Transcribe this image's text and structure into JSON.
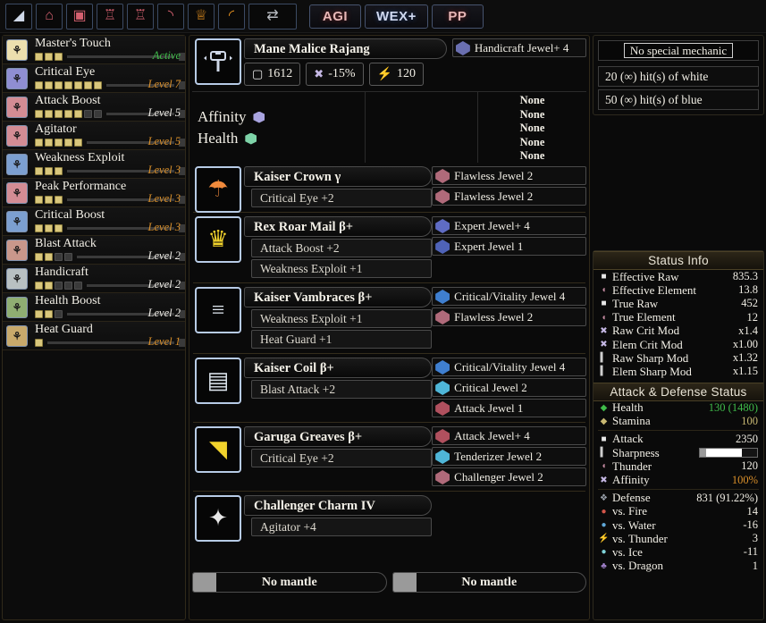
{
  "toolbar": {
    "icons": [
      {
        "name": "weapon-longsword-icon",
        "glyph": "◢"
      },
      {
        "name": "armor-head-icon",
        "glyph": "⌂"
      },
      {
        "name": "armor-chest-icon",
        "glyph": "▣"
      },
      {
        "name": "armor-arms-icon",
        "glyph": "♖"
      },
      {
        "name": "armor-waist-icon",
        "glyph": "♖"
      },
      {
        "name": "armor-legs-icon",
        "glyph": "◝"
      },
      {
        "name": "charm-icon",
        "glyph": "♕"
      },
      {
        "name": "decoration-icon",
        "glyph": "◜"
      },
      {
        "name": "weapon-swap-icon",
        "glyph": "⇄"
      }
    ],
    "buttons": [
      {
        "name": "agi-button",
        "label": "AGI",
        "style": "red"
      },
      {
        "name": "wex-button",
        "label": "WEX+",
        "style": "blue"
      },
      {
        "name": "pp-button",
        "label": "PP",
        "style": "red"
      }
    ]
  },
  "sidebar": {
    "skills": [
      {
        "name": "Master's Touch",
        "filled": 3,
        "empty": 0,
        "level": "Active",
        "level_style": "green",
        "color": "#ecdfae"
      },
      {
        "name": "Critical Eye",
        "filled": 7,
        "empty": 0,
        "level": "Level 7",
        "level_style": "orange",
        "color": "#8f8ed2"
      },
      {
        "name": "Attack Boost",
        "filled": 5,
        "empty": 2,
        "level": "Level 5",
        "level_style": "white",
        "color": "#d38c94"
      },
      {
        "name": "Agitator",
        "filled": 5,
        "empty": 0,
        "level": "Level 5",
        "level_style": "orange",
        "color": "#d38c94"
      },
      {
        "name": "Weakness Exploit",
        "filled": 3,
        "empty": 0,
        "level": "Level 3",
        "level_style": "orange",
        "color": "#7c9fd0"
      },
      {
        "name": "Peak Performance",
        "filled": 3,
        "empty": 0,
        "level": "Level 3",
        "level_style": "orange",
        "color": "#d38c94"
      },
      {
        "name": "Critical Boost",
        "filled": 3,
        "empty": 0,
        "level": "Level 3",
        "level_style": "orange",
        "color": "#7c9fd0"
      },
      {
        "name": "Blast Attack",
        "filled": 2,
        "empty": 2,
        "level": "Level 2",
        "level_style": "white",
        "color": "#c9978b"
      },
      {
        "name": "Handicraft",
        "filled": 2,
        "empty": 3,
        "level": "Level 2",
        "level_style": "white",
        "color": "#b8c0c2"
      },
      {
        "name": "Health Boost",
        "filled": 2,
        "empty": 1,
        "level": "Level 2",
        "level_style": "white",
        "color": "#8fae72"
      },
      {
        "name": "Heat Guard",
        "filled": 1,
        "empty": 0,
        "level": "Level 1",
        "level_style": "orange",
        "color": "#c8a96b"
      }
    ]
  },
  "weapon": {
    "icon_name": "hammer-icon",
    "name": "Mane Malice Rajang",
    "attack": "1612",
    "affinity": "-15%",
    "element": "120",
    "decorations": [
      {
        "label": "Handicraft Jewel+ 4",
        "gem": "attack-gem",
        "color": "#6a6fb0"
      }
    ],
    "affinity_label": "Affinity",
    "health_label": "Health",
    "affinity_gem_color": "#a9a4e0",
    "health_gem_color": "#7ed3a8",
    "none_entries": [
      "None",
      "None",
      "None",
      "None",
      "None"
    ]
  },
  "armor": [
    {
      "icon_name": "helmet-icon",
      "icon_glyph": "☂",
      "icon_color": "#f08a3c",
      "name": "Kaiser Crown γ",
      "skills": [
        "Critical Eye +2"
      ],
      "decorations": [
        {
          "label": "Flawless Jewel 2",
          "color": "#b06a7a"
        },
        {
          "label": "Flawless Jewel 2",
          "color": "#b06a7a"
        }
      ]
    },
    {
      "icon_name": "chest-icon",
      "icon_glyph": "♛",
      "icon_color": "#f2d32c",
      "name": "Rex Roar Mail β+",
      "skills": [
        "Attack Boost +2",
        "Weakness Exploit +1"
      ],
      "decorations": [
        {
          "label": "Expert Jewel+ 4",
          "color": "#5f6cc4"
        },
        {
          "label": "Expert Jewel 1",
          "color": "#4f63b8"
        }
      ]
    },
    {
      "icon_name": "gauntlets-icon",
      "icon_glyph": "≡",
      "icon_color": "#dfe7ef",
      "name": "Kaiser Vambraces β+",
      "skills": [
        "Weakness Exploit +1",
        "Heat Guard +1"
      ],
      "decorations": [
        {
          "label": "Critical/Vitality Jewel 4",
          "color": "#3f7fd0"
        },
        {
          "label": "Flawless Jewel 2",
          "color": "#b06a7a"
        }
      ]
    },
    {
      "icon_name": "waist-icon",
      "icon_glyph": "▤",
      "icon_color": "#dfe7ef",
      "name": "Kaiser Coil β+",
      "skills": [
        "Blast Attack +2"
      ],
      "decorations": [
        {
          "label": "Critical/Vitality Jewel 4",
          "color": "#3f7fd0"
        },
        {
          "label": "Critical Jewel 2",
          "color": "#4fb6d8"
        },
        {
          "label": "Attack Jewel 1",
          "color": "#b0505e"
        }
      ]
    },
    {
      "icon_name": "greaves-icon",
      "icon_glyph": "◥",
      "icon_color": "#f2d32c",
      "name": "Garuga Greaves β+",
      "skills": [
        "Critical Eye +2"
      ],
      "decorations": [
        {
          "label": "Attack Jewel+ 4",
          "color": "#b0505e"
        },
        {
          "label": "Tenderizer Jewel 2",
          "color": "#4fb6d8"
        },
        {
          "label": "Challenger Jewel 2",
          "color": "#b06a7a"
        }
      ]
    },
    {
      "icon_name": "charm-icon",
      "icon_glyph": "✦",
      "icon_color": "#e8e8e8",
      "name": "Challenger Charm IV",
      "skills": [
        "Agitator +4"
      ],
      "decorations": []
    }
  ],
  "mantles": [
    {
      "label": "No mantle"
    },
    {
      "label": "No mantle"
    }
  ],
  "right_top": {
    "special_mechanic": "No special mechanic",
    "hits": [
      "20 (∞) hit(s) of white",
      "50 (∞) hit(s) of blue"
    ]
  },
  "status_info": {
    "header": "Status Info",
    "rows": [
      {
        "icon": "raw-icon",
        "label": "Effective Raw",
        "value": "835.3"
      },
      {
        "icon": "element-icon",
        "label": "Effective Element",
        "value": "13.8"
      },
      {
        "icon": "raw-icon",
        "label": "True Raw",
        "value": "452"
      },
      {
        "icon": "element-icon",
        "label": "True Element",
        "value": "12"
      },
      {
        "icon": "affinity-icon",
        "label": "Raw Crit Mod",
        "value": "x1.4"
      },
      {
        "icon": "affinity-icon",
        "label": "Elem Crit Mod",
        "value": "x1.00"
      },
      {
        "icon": "sharpness-icon",
        "label": "Raw Sharp Mod",
        "value": "x1.32"
      },
      {
        "icon": "sharpness-icon",
        "label": "Elem Sharp Mod",
        "value": "x1.15"
      }
    ]
  },
  "attack_defense": {
    "header": "Attack & Defense Status",
    "vitals": [
      {
        "icon": "health-icon",
        "label": "Health",
        "value": "130 (1480)",
        "color": "#3fbb4a"
      },
      {
        "icon": "stamina-icon",
        "label": "Stamina",
        "value": "100",
        "color": "#c8b872"
      }
    ],
    "offense": [
      {
        "icon": "raw-icon",
        "label": "Attack",
        "value": "2350"
      },
      {
        "icon": "sharpness-icon",
        "label": "Sharpness",
        "value": "",
        "bar": true
      },
      {
        "icon": "element-icon",
        "label": "Thunder",
        "value": "120"
      },
      {
        "icon": "affinity-icon",
        "label": "Affinity",
        "value": "100%",
        "value_style": "orange"
      }
    ],
    "defense": [
      {
        "icon": "defense-icon",
        "label": "Defense",
        "value": "831 (91.22%)"
      },
      {
        "icon": "fire-icon",
        "label": "vs. Fire",
        "value": "14"
      },
      {
        "icon": "water-icon",
        "label": "vs. Water",
        "value": "-16"
      },
      {
        "icon": "thunder-icon",
        "label": "vs. Thunder",
        "value": "3"
      },
      {
        "icon": "ice-icon",
        "label": "vs. Ice",
        "value": "-11"
      },
      {
        "icon": "dragon-icon",
        "label": "vs. Dragon",
        "value": "1"
      }
    ]
  }
}
